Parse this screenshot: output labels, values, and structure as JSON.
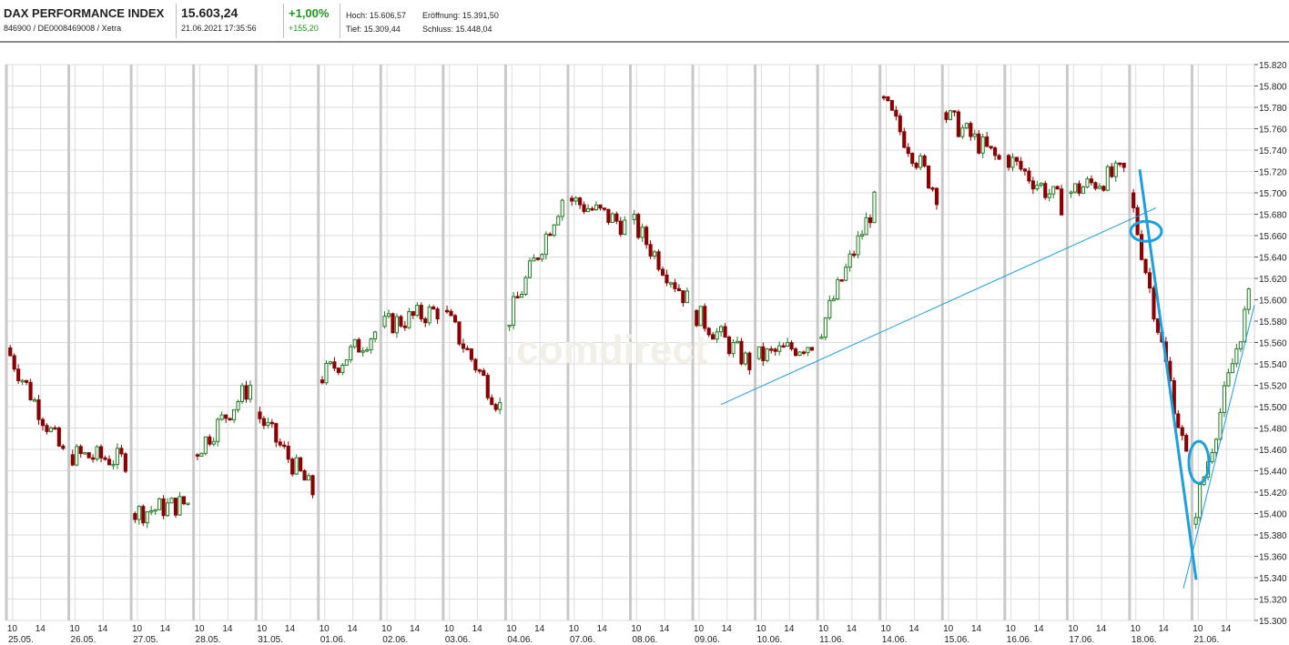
{
  "header": {
    "index_name": "DAX PERFORMANCE INDEX",
    "wkn_isin": "846900 / DE0008469008 / Xetra",
    "price": "15.603,24",
    "datetime": "21.06.2021 17:35:56",
    "change_pct": "+1,00%",
    "change_abs": "+155,20",
    "high": "Hoch: 15.606,57",
    "open": "Eröffnung: 15.391,50",
    "low": "Tief: 15.309,44",
    "close": "Schluss: 15.448,04",
    "accent_positive": "#1a9a1a"
  },
  "watermark": ".comdirect",
  "chart_data": {
    "type": "line",
    "style": "intraday candlestick (green up / dark red down)",
    "x_tick_labels_hours": [
      "10",
      "14"
    ],
    "days": [
      {
        "date": "25.05.",
        "open": 15555,
        "close": 15455
      },
      {
        "date": "26.05.",
        "open": 15455,
        "close": 15450
      },
      {
        "date": "27.05.",
        "open": 15400,
        "close": 15410
      },
      {
        "date": "28.05.",
        "open": 15455,
        "close": 15520
      },
      {
        "date": "31.05.",
        "open": 15495,
        "close": 15420
      },
      {
        "date": "01.06.",
        "open": 15525,
        "close": 15570
      },
      {
        "date": "02.06.",
        "open": 15575,
        "close": 15590
      },
      {
        "date": "03.06.",
        "open": 15590,
        "close": 15500
      },
      {
        "date": "04.06.",
        "open": 15575,
        "close": 15695
      },
      {
        "date": "07.06.",
        "open": 15695,
        "close": 15670
      },
      {
        "date": "08.06.",
        "open": 15675,
        "close": 15600
      },
      {
        "date": "09.06.",
        "open": 15590,
        "close": 15540
      },
      {
        "date": "10.06.",
        "open": 15545,
        "close": 15560
      },
      {
        "date": "11.06.",
        "open": 15565,
        "close": 15690
      },
      {
        "date": "14.06.",
        "open": 15790,
        "close": 15700
      },
      {
        "date": "15.06.",
        "open": 15775,
        "close": 15730
      },
      {
        "date": "16.06.",
        "open": 15735,
        "close": 15690
      },
      {
        "date": "17.06.",
        "open": 15700,
        "close": 15720
      },
      {
        "date": "18.06.",
        "open": 15700,
        "close": 15450
      },
      {
        "date": "21.06.",
        "open": 15390,
        "close": 15600
      }
    ],
    "ylim": [
      15300,
      15820
    ],
    "y_ticks": [
      "15.300",
      "15.320",
      "15.340",
      "15.360",
      "15.380",
      "15.400",
      "15.420",
      "15.440",
      "15.460",
      "15.480",
      "15.500",
      "15.520",
      "15.540",
      "15.560",
      "15.580",
      "15.600",
      "15.620",
      "15.640",
      "15.660",
      "15.680",
      "15.700",
      "15.720",
      "15.740",
      "15.760",
      "15.780",
      "15.800",
      "15.820"
    ],
    "grid": true,
    "colors": {
      "up": "#1e7d1e",
      "down": "#8b0000",
      "grid": "#dcdcdc",
      "day_separator": "#c9c9c9",
      "trendline": "#1a9fe0"
    }
  }
}
